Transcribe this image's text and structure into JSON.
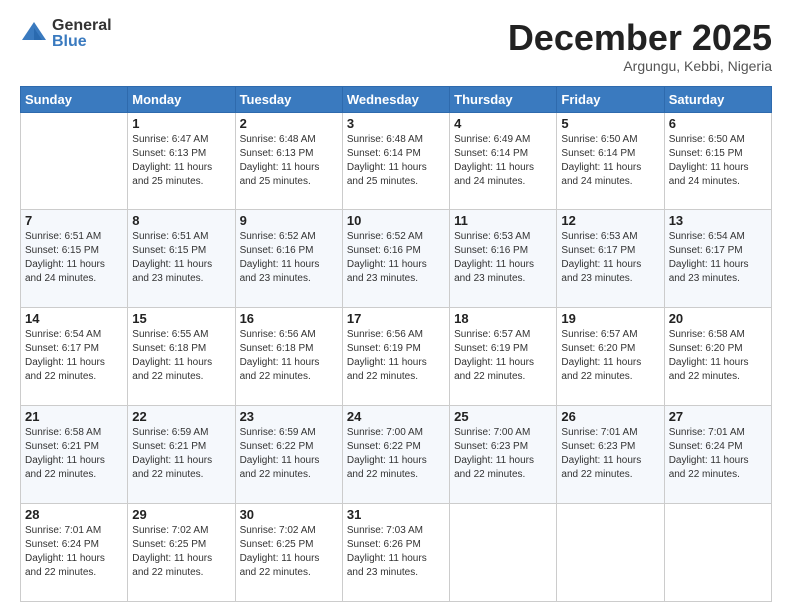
{
  "logo": {
    "general": "General",
    "blue": "Blue"
  },
  "title": {
    "month": "December 2025",
    "location": "Argungu, Kebbi, Nigeria"
  },
  "days": [
    "Sunday",
    "Monday",
    "Tuesday",
    "Wednesday",
    "Thursday",
    "Friday",
    "Saturday"
  ],
  "weeks": [
    [
      {
        "num": "",
        "sunrise": "",
        "sunset": "",
        "daylight": ""
      },
      {
        "num": "1",
        "sunrise": "Sunrise: 6:47 AM",
        "sunset": "Sunset: 6:13 PM",
        "daylight": "Daylight: 11 hours and 25 minutes."
      },
      {
        "num": "2",
        "sunrise": "Sunrise: 6:48 AM",
        "sunset": "Sunset: 6:13 PM",
        "daylight": "Daylight: 11 hours and 25 minutes."
      },
      {
        "num": "3",
        "sunrise": "Sunrise: 6:48 AM",
        "sunset": "Sunset: 6:14 PM",
        "daylight": "Daylight: 11 hours and 25 minutes."
      },
      {
        "num": "4",
        "sunrise": "Sunrise: 6:49 AM",
        "sunset": "Sunset: 6:14 PM",
        "daylight": "Daylight: 11 hours and 24 minutes."
      },
      {
        "num": "5",
        "sunrise": "Sunrise: 6:50 AM",
        "sunset": "Sunset: 6:14 PM",
        "daylight": "Daylight: 11 hours and 24 minutes."
      },
      {
        "num": "6",
        "sunrise": "Sunrise: 6:50 AM",
        "sunset": "Sunset: 6:15 PM",
        "daylight": "Daylight: 11 hours and 24 minutes."
      }
    ],
    [
      {
        "num": "7",
        "sunrise": "Sunrise: 6:51 AM",
        "sunset": "Sunset: 6:15 PM",
        "daylight": "Daylight: 11 hours and 24 minutes."
      },
      {
        "num": "8",
        "sunrise": "Sunrise: 6:51 AM",
        "sunset": "Sunset: 6:15 PM",
        "daylight": "Daylight: 11 hours and 23 minutes."
      },
      {
        "num": "9",
        "sunrise": "Sunrise: 6:52 AM",
        "sunset": "Sunset: 6:16 PM",
        "daylight": "Daylight: 11 hours and 23 minutes."
      },
      {
        "num": "10",
        "sunrise": "Sunrise: 6:52 AM",
        "sunset": "Sunset: 6:16 PM",
        "daylight": "Daylight: 11 hours and 23 minutes."
      },
      {
        "num": "11",
        "sunrise": "Sunrise: 6:53 AM",
        "sunset": "Sunset: 6:16 PM",
        "daylight": "Daylight: 11 hours and 23 minutes."
      },
      {
        "num": "12",
        "sunrise": "Sunrise: 6:53 AM",
        "sunset": "Sunset: 6:17 PM",
        "daylight": "Daylight: 11 hours and 23 minutes."
      },
      {
        "num": "13",
        "sunrise": "Sunrise: 6:54 AM",
        "sunset": "Sunset: 6:17 PM",
        "daylight": "Daylight: 11 hours and 23 minutes."
      }
    ],
    [
      {
        "num": "14",
        "sunrise": "Sunrise: 6:54 AM",
        "sunset": "Sunset: 6:17 PM",
        "daylight": "Daylight: 11 hours and 22 minutes."
      },
      {
        "num": "15",
        "sunrise": "Sunrise: 6:55 AM",
        "sunset": "Sunset: 6:18 PM",
        "daylight": "Daylight: 11 hours and 22 minutes."
      },
      {
        "num": "16",
        "sunrise": "Sunrise: 6:56 AM",
        "sunset": "Sunset: 6:18 PM",
        "daylight": "Daylight: 11 hours and 22 minutes."
      },
      {
        "num": "17",
        "sunrise": "Sunrise: 6:56 AM",
        "sunset": "Sunset: 6:19 PM",
        "daylight": "Daylight: 11 hours and 22 minutes."
      },
      {
        "num": "18",
        "sunrise": "Sunrise: 6:57 AM",
        "sunset": "Sunset: 6:19 PM",
        "daylight": "Daylight: 11 hours and 22 minutes."
      },
      {
        "num": "19",
        "sunrise": "Sunrise: 6:57 AM",
        "sunset": "Sunset: 6:20 PM",
        "daylight": "Daylight: 11 hours and 22 minutes."
      },
      {
        "num": "20",
        "sunrise": "Sunrise: 6:58 AM",
        "sunset": "Sunset: 6:20 PM",
        "daylight": "Daylight: 11 hours and 22 minutes."
      }
    ],
    [
      {
        "num": "21",
        "sunrise": "Sunrise: 6:58 AM",
        "sunset": "Sunset: 6:21 PM",
        "daylight": "Daylight: 11 hours and 22 minutes."
      },
      {
        "num": "22",
        "sunrise": "Sunrise: 6:59 AM",
        "sunset": "Sunset: 6:21 PM",
        "daylight": "Daylight: 11 hours and 22 minutes."
      },
      {
        "num": "23",
        "sunrise": "Sunrise: 6:59 AM",
        "sunset": "Sunset: 6:22 PM",
        "daylight": "Daylight: 11 hours and 22 minutes."
      },
      {
        "num": "24",
        "sunrise": "Sunrise: 7:00 AM",
        "sunset": "Sunset: 6:22 PM",
        "daylight": "Daylight: 11 hours and 22 minutes."
      },
      {
        "num": "25",
        "sunrise": "Sunrise: 7:00 AM",
        "sunset": "Sunset: 6:23 PM",
        "daylight": "Daylight: 11 hours and 22 minutes."
      },
      {
        "num": "26",
        "sunrise": "Sunrise: 7:01 AM",
        "sunset": "Sunset: 6:23 PM",
        "daylight": "Daylight: 11 hours and 22 minutes."
      },
      {
        "num": "27",
        "sunrise": "Sunrise: 7:01 AM",
        "sunset": "Sunset: 6:24 PM",
        "daylight": "Daylight: 11 hours and 22 minutes."
      }
    ],
    [
      {
        "num": "28",
        "sunrise": "Sunrise: 7:01 AM",
        "sunset": "Sunset: 6:24 PM",
        "daylight": "Daylight: 11 hours and 22 minutes."
      },
      {
        "num": "29",
        "sunrise": "Sunrise: 7:02 AM",
        "sunset": "Sunset: 6:25 PM",
        "daylight": "Daylight: 11 hours and 22 minutes."
      },
      {
        "num": "30",
        "sunrise": "Sunrise: 7:02 AM",
        "sunset": "Sunset: 6:25 PM",
        "daylight": "Daylight: 11 hours and 22 minutes."
      },
      {
        "num": "31",
        "sunrise": "Sunrise: 7:03 AM",
        "sunset": "Sunset: 6:26 PM",
        "daylight": "Daylight: 11 hours and 23 minutes."
      },
      {
        "num": "",
        "sunrise": "",
        "sunset": "",
        "daylight": ""
      },
      {
        "num": "",
        "sunrise": "",
        "sunset": "",
        "daylight": ""
      },
      {
        "num": "",
        "sunrise": "",
        "sunset": "",
        "daylight": ""
      }
    ]
  ]
}
